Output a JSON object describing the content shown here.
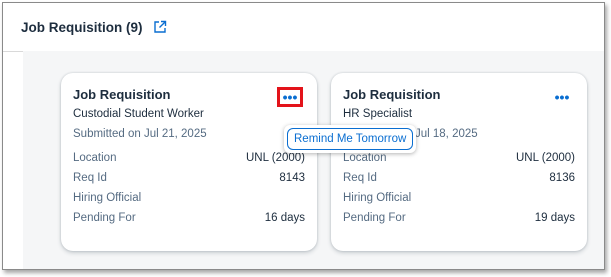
{
  "header": {
    "title": "Job Requisition (9)"
  },
  "cards": [
    {
      "title": "Job Requisition",
      "subtitle": "Custodial Student Worker",
      "submitted": "Submitted on Jul 21, 2025",
      "fields": [
        {
          "label": "Location",
          "value": "UNL (2000)"
        },
        {
          "label": "Req Id",
          "value": "8143"
        },
        {
          "label": "Hiring Official",
          "value": ""
        },
        {
          "label": "Pending For",
          "value": "16 days"
        }
      ]
    },
    {
      "title": "Job Requisition",
      "subtitle": "HR Specialist",
      "submitted": "Jul 18, 2025",
      "fields": [
        {
          "label": "Location",
          "value": "UNL (2000)"
        },
        {
          "label": "Req Id",
          "value": "8136"
        },
        {
          "label": "Hiring Official",
          "value": ""
        },
        {
          "label": "Pending For",
          "value": "19 days"
        }
      ]
    }
  ],
  "more_label": "•••",
  "popover": {
    "action_label": "Remind Me Tomorrow"
  },
  "colors": {
    "accent": "#0a6ed1",
    "highlight": "#e3131a"
  },
  "icons": {
    "header": "external-link-icon",
    "card_more": "more-options-icon"
  }
}
